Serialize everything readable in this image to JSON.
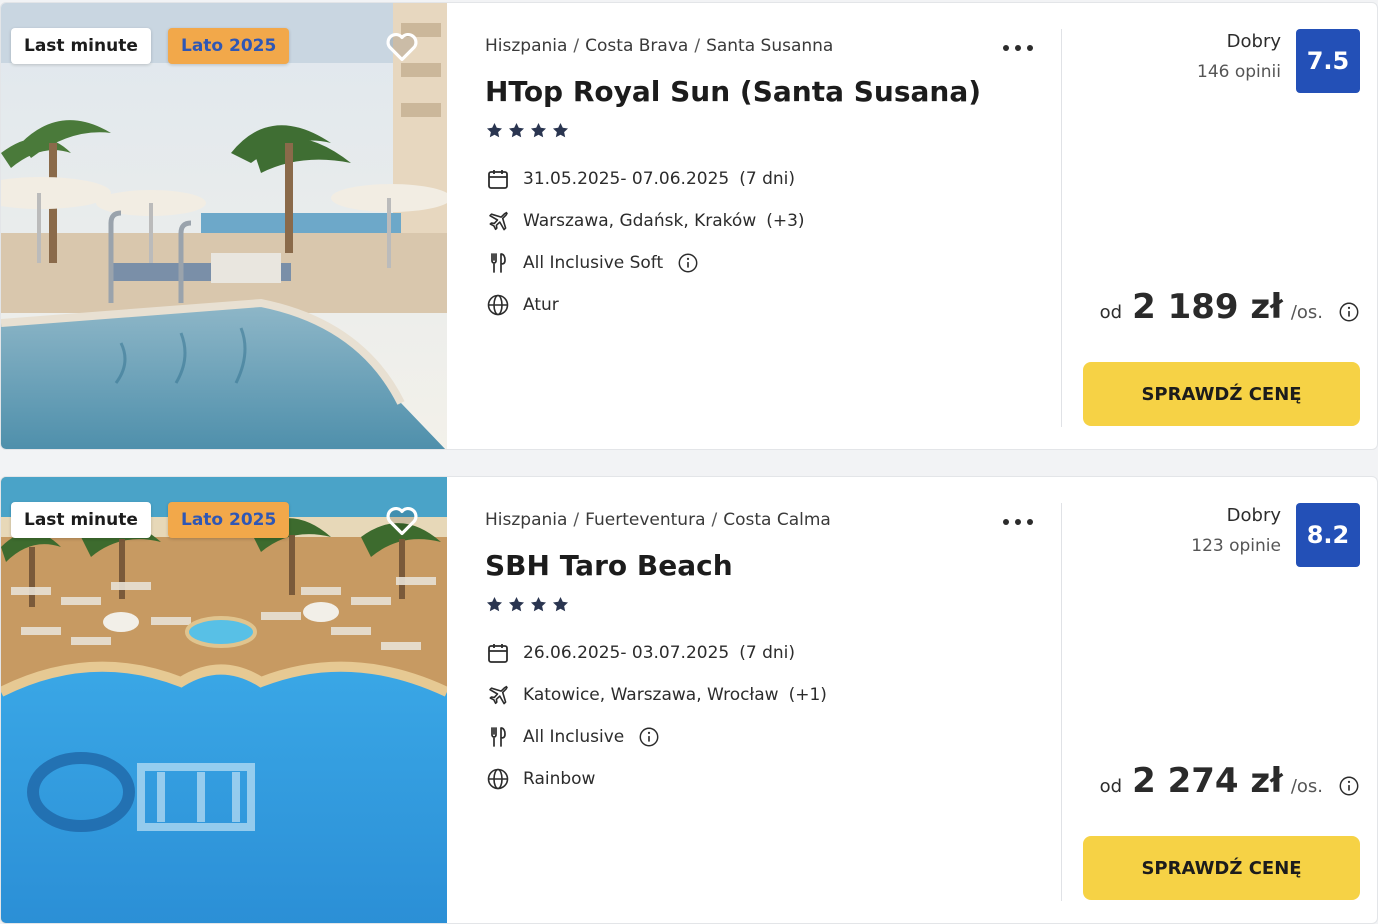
{
  "colors": {
    "accent_blue": "#2350b7",
    "cta_yellow": "#f6d245",
    "tag_orange": "#f2a84a",
    "star": "#2a3550"
  },
  "offers": [
    {
      "tags": [
        "Last minute",
        "Lato 2025"
      ],
      "breadcrumb": [
        "Hiszpania",
        "Costa Brava",
        "Santa Susanna"
      ],
      "breadcrumb_separator": "/",
      "name": "HTop Royal Sun (Santa Susana)",
      "stars": 4,
      "dates": "31.05.2025- 07.06.2025",
      "duration": "(7 dni)",
      "departures": "Warszawa, Gdańsk, Kraków",
      "departures_more": "(+3)",
      "board": "All Inclusive Soft",
      "operator": "Atur",
      "rating_label": "Dobry",
      "reviews": "146 opinii",
      "score": "7.5",
      "price_prefix": "od",
      "price": "2 189 zł",
      "price_suffix": "/os.",
      "cta": "SPRAWDŹ CENĘ"
    },
    {
      "tags": [
        "Last minute",
        "Lato 2025"
      ],
      "breadcrumb": [
        "Hiszpania",
        "Fuerteventura",
        "Costa Calma"
      ],
      "breadcrumb_separator": "/",
      "name": "SBH Taro Beach",
      "stars": 4,
      "dates": "26.06.2025- 03.07.2025",
      "duration": "(7 dni)",
      "departures": "Katowice, Warszawa, Wrocław",
      "departures_more": "(+1)",
      "board": "All Inclusive",
      "operator": "Rainbow",
      "rating_label": "Dobry",
      "reviews": "123 opinie",
      "score": "8.2",
      "price_prefix": "od",
      "price": "2 274 zł",
      "price_suffix": "/os.",
      "cta": "SPRAWDŹ CENĘ"
    }
  ],
  "icons": {
    "favorite": "heart-icon",
    "more": "more-dots-icon",
    "dates": "calendar-icon",
    "departures": "plane-icon",
    "board": "cutlery-icon",
    "operator": "globe-icon",
    "info": "info-icon",
    "rating": "star-icon"
  }
}
